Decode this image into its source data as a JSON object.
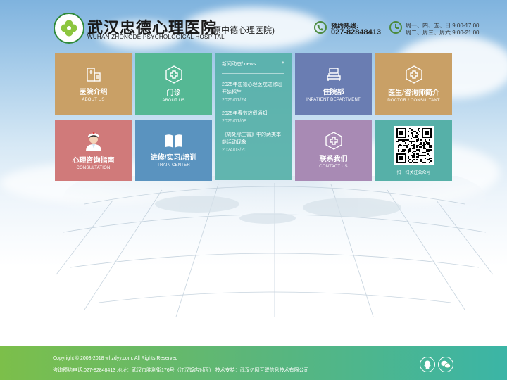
{
  "header": {
    "title": "武汉忠德心理医院",
    "subtitle_en": "WUHAN ZHONGDE PSYCHOLOGICAL HOSPITAL",
    "former_name": "(原中德心理医院)",
    "hotline_label": "预约热线:",
    "hotline_number": "027-82848413",
    "hours_line1": "周一、四、五、日 9:00-17:00",
    "hours_line2": "周二、周三、周六 9:00-21:00"
  },
  "tiles": [
    {
      "id": "about",
      "title": "医院介绍",
      "subtitle": "ABOUT US",
      "color": "#c9a066",
      "icon": "building-icon"
    },
    {
      "id": "clinic",
      "title": "门诊",
      "subtitle": "ABOUT US",
      "color": "#55b894",
      "icon": "medical-cross-icon"
    },
    {
      "id": "inpatient",
      "title": "住院部",
      "subtitle": "INPATIENT DEPARTMENT",
      "color": "#6a7db2",
      "icon": "bed-icon"
    },
    {
      "id": "doctors",
      "title": "医生/咨询师简介",
      "subtitle": "DOCTOR / CONSULTANT",
      "color": "#c9a066",
      "icon": "medical-cross-icon"
    },
    {
      "id": "consult",
      "title": "心理咨询指南",
      "subtitle": "CONSULTATION",
      "color": "#d07a7a",
      "icon": "doctor-icon"
    },
    {
      "id": "train",
      "title": "进修/实习/培训",
      "subtitle": "TRAIN CENTER",
      "color": "#5a93bf",
      "icon": "book-icon"
    },
    {
      "id": "contact",
      "title": "联系我们",
      "subtitle": "CONTACT US",
      "color": "#a88ab4",
      "icon": "medical-cross-icon"
    }
  ],
  "news": {
    "heading": "新闻动态/ news",
    "more": "+",
    "items": [
      {
        "title": "2025年忠德心理医院进修班开始招生",
        "date": "2025/01/24"
      },
      {
        "title": "2025年春节放假通知",
        "date": "2025/01/08"
      },
      {
        "title": "《周处除三害》中的两类本能活动现象",
        "date": "2024/03/20"
      }
    ]
  },
  "qr": {
    "caption": "扫一扫关注公众号",
    "icon": "qr-code-icon"
  },
  "footer": {
    "copyright": "Copyright © 2003-2018 whzdyy.com, All Rights Reserved",
    "contact": "咨询预约电话:027-82848413 地址：武汉市胜利街176号（江汉饭店对面） 技术支持：武汉亿网互联信息技术有限公司",
    "icons": [
      "qq-icon",
      "wechat-icon"
    ]
  },
  "colors": {
    "footer_start": "#7cbf4a",
    "footer_end": "#3bb5a6",
    "news_bg": "#56b0a8",
    "brand_green": "#2f8a3a"
  }
}
